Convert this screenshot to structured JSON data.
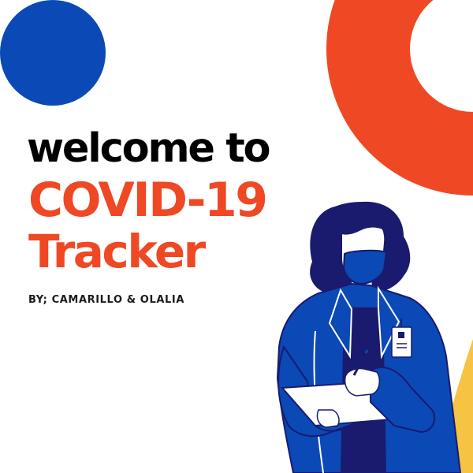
{
  "headline": {
    "line1": "welcome to",
    "line2": "COVID-19",
    "line3": "Tracker"
  },
  "byline": "BY; CAMARILLO & OLALIA",
  "colors": {
    "background": "#ffffff",
    "blue": "#0a49b6",
    "orange_red": "#ef4824",
    "yellow": "#f6c343",
    "navy": "#1a1a6e",
    "text_dark": "#000000"
  },
  "illustration": {
    "icon": "health-worker-with-mask-and-clipboard"
  }
}
